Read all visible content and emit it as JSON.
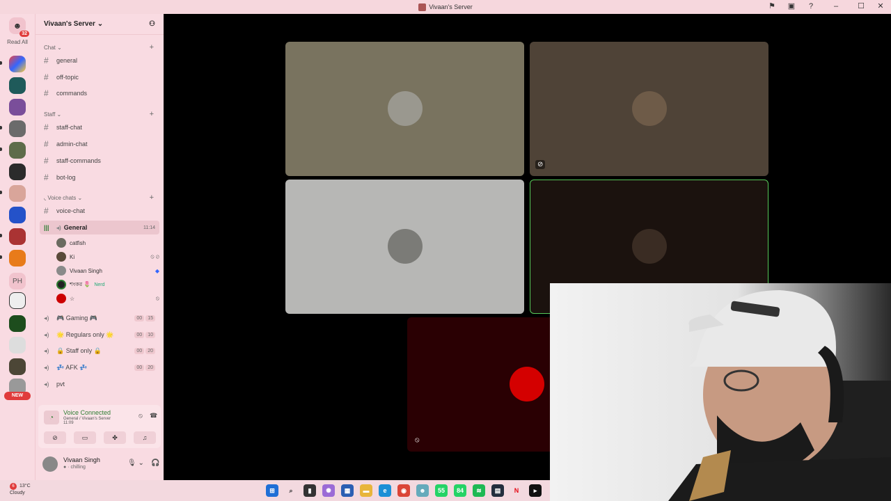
{
  "window": {
    "title": "Vivaan's Server"
  },
  "rail": {
    "home_badge": "32",
    "read_all": "Read All",
    "ph_label": "PH",
    "new_badge": "NEW"
  },
  "server": {
    "name": "Vivaan's Server"
  },
  "categories": [
    {
      "label": "Chat"
    },
    {
      "label": "Staff"
    },
    {
      "label": "Voice chats"
    }
  ],
  "text_channels": [
    "general",
    "off-topic",
    "commands",
    "staff-chat",
    "admin-chat",
    "staff-commands",
    "bot-log",
    "voice-chat"
  ],
  "active_voice": {
    "name": "General",
    "time": "11:14"
  },
  "voice_users": [
    {
      "name": "catfish"
    },
    {
      "name": "Ki"
    },
    {
      "name": "Vivaan Singh"
    },
    {
      "name": "শংকর 🌷",
      "tag": "Nerd"
    },
    {
      "name": "☆"
    }
  ],
  "voice_channels": [
    {
      "name": "🎮 Gaming 🎮",
      "count_a": "00",
      "count_b": "15"
    },
    {
      "name": "🌟 Regulars only 🌟",
      "count_a": "00",
      "count_b": "10"
    },
    {
      "name": "🔒 Staff only 🔒",
      "count_a": "00",
      "count_b": "20"
    },
    {
      "name": "💤 AFK 💤",
      "count_a": "00",
      "count_b": "20"
    },
    {
      "name": "pvt"
    }
  ],
  "voice_status": {
    "title": "Voice Connected",
    "sub": "General / Vivaan's Server",
    "time": "11:09"
  },
  "user": {
    "name": "Vivaan Singh",
    "status": "chilling"
  },
  "weather": {
    "temp": "13°C",
    "cond": "Cloudy",
    "badge": "6"
  },
  "taskbar_badges": {
    "whatsapp_a": "55",
    "whatsapp_b": "84"
  },
  "colors": {
    "sidebar": "#f9dbe2",
    "accent_green": "#2e7d32",
    "speaking_border": "#58c95a"
  }
}
